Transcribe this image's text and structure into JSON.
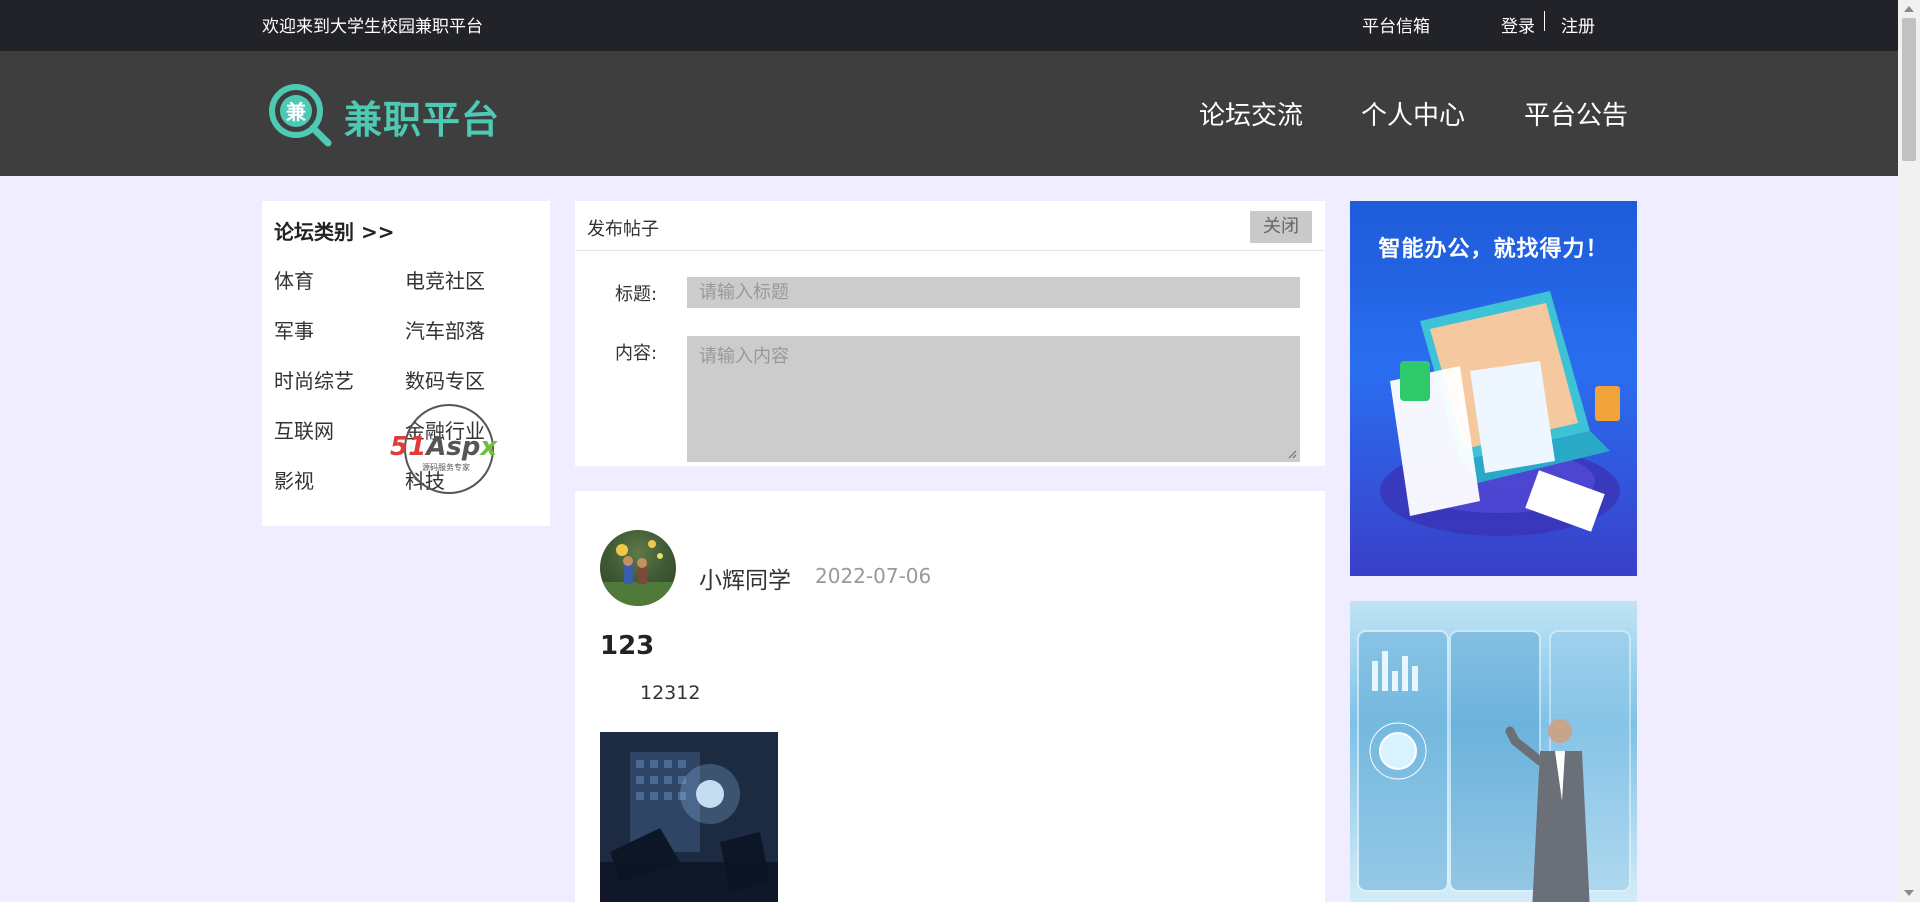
{
  "topbar": {
    "welcome": "欢迎来到大学生校园兼职平台",
    "mailbox": "平台信箱",
    "login": "登录",
    "register": "注册"
  },
  "header": {
    "logo_char": "兼",
    "brand": "兼职平台",
    "nav": [
      "论坛交流",
      "个人中心",
      "平台公告"
    ]
  },
  "sidebar": {
    "title": "论坛类别 >>",
    "categories": [
      "体育",
      "电竞社区",
      "军事",
      "汽车部落",
      "时尚综艺",
      "数码专区",
      "互联网",
      "金融行业",
      "影视",
      "科技"
    ]
  },
  "watermark": {
    "text": "51Aspx",
    "subtext": "源码服务专家"
  },
  "post_form": {
    "heading": "发布帖子",
    "close_label": "关闭",
    "title_label": "标题:",
    "title_placeholder": "请输入标题",
    "content_label": "内容:",
    "content_placeholder": "请输入内容"
  },
  "post": {
    "author": "小辉同学",
    "date": "2022-07-06",
    "title": "123",
    "body": "12312"
  },
  "ads": {
    "ad1_slogan": "智能办公，就找得力！"
  },
  "colors": {
    "topbar_bg": "#212329",
    "header_bg": "#3e3e3e",
    "brand_accent": "#4ec9b4",
    "page_bg": "#efedff",
    "input_bg": "#cccccc"
  },
  "icons": [
    "magnifier-logo-icon",
    "resize-handle-icon",
    "avatar-image",
    "movie-poster-image",
    "office-ad-image",
    "tech-ad-image"
  ]
}
